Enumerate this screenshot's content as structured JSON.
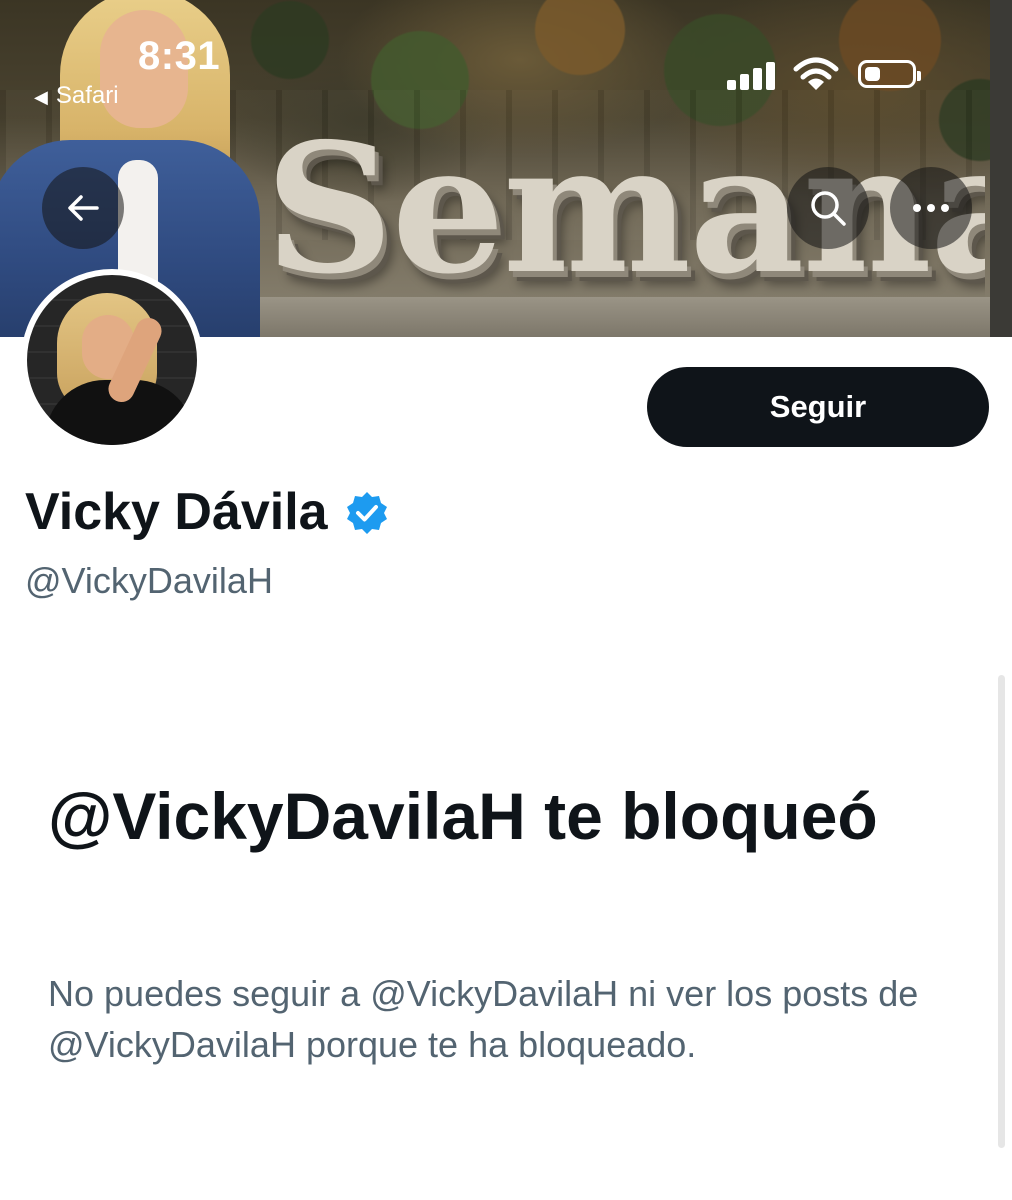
{
  "status_bar": {
    "time": "8:31",
    "back_app": "Safari",
    "signal_bars": 4,
    "wifi": "wifi-icon",
    "battery_level": 0.35
  },
  "header": {
    "banner_sign_text": "Semana",
    "back_icon": "arrow-left-icon",
    "search_icon": "search-icon",
    "more_icon": "more-horizontal-icon"
  },
  "profile": {
    "display_name": "Vicky Dávila",
    "verified": true,
    "handle": "@VickyDavilaH",
    "follow_label": "Seguir"
  },
  "blocked": {
    "title": "@VickyDavilaH te bloqueó",
    "body": "No puedes seguir a @VickyDavilaH ni ver los posts de @VickyDavilaH porque te ha bloqueado."
  },
  "colors": {
    "primary_text": "#0f1419",
    "secondary_text": "#536471",
    "verified_blue": "#1d9bf0",
    "button_bg": "#0f1419"
  }
}
